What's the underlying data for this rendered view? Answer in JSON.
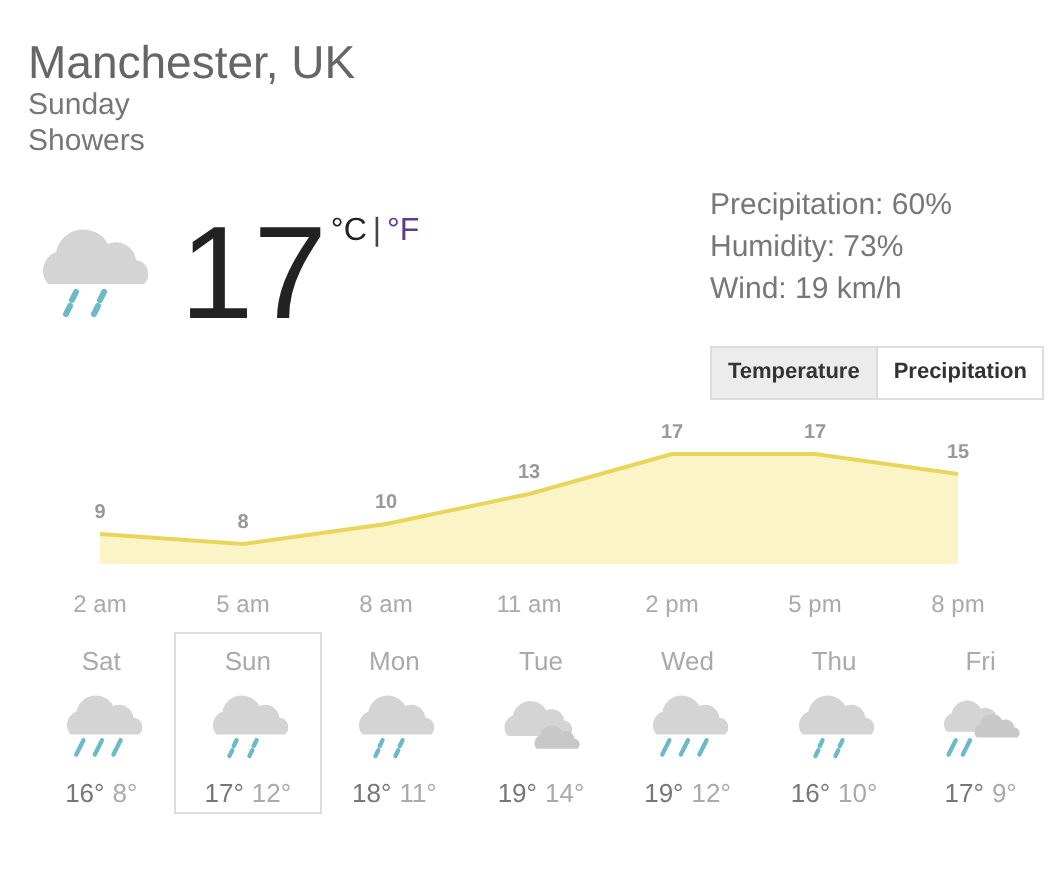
{
  "location": "Manchester, UK",
  "day": "Sunday",
  "condition": "Showers",
  "current": {
    "kind": "rain",
    "temperature": "17",
    "units": [
      {
        "label": "°C",
        "selected": true
      },
      {
        "label": "°F",
        "selected": false
      }
    ],
    "unit_separator": "|"
  },
  "details": [
    "Precipitation: 60%",
    "Humidity: 73%",
    "Wind: 19 km/h"
  ],
  "tabs": [
    {
      "label": "Temperature",
      "selected": true
    },
    {
      "label": "Precipitation",
      "selected": false
    }
  ],
  "chart": {
    "chart_data": {
      "type": "area",
      "categories": [
        "2 am",
        "5 am",
        "8 am",
        "11 am",
        "2 pm",
        "5 pm",
        "8 pm"
      ],
      "values": [
        9,
        8,
        10,
        13,
        17,
        17,
        15
      ],
      "data_labels": true
    }
  },
  "forecast": [
    {
      "day": "Sat",
      "kind": "heavy_rain",
      "high": "16°",
      "low": "8°",
      "selected": false
    },
    {
      "day": "Sun",
      "kind": "rain",
      "high": "17°",
      "low": "12°",
      "selected": true
    },
    {
      "day": "Mon",
      "kind": "rain",
      "high": "18°",
      "low": "11°",
      "selected": false
    },
    {
      "day": "Tue",
      "kind": "cloudy",
      "high": "19°",
      "low": "14°",
      "selected": false
    },
    {
      "day": "Wed",
      "kind": "heavy_rain",
      "high": "19°",
      "low": "12°",
      "selected": false
    },
    {
      "day": "Thu",
      "kind": "rain",
      "high": "16°",
      "low": "10°",
      "selected": false
    },
    {
      "day": "Fri",
      "kind": "cloudy_rain",
      "high": "17°",
      "low": "9°",
      "selected": false
    }
  ]
}
